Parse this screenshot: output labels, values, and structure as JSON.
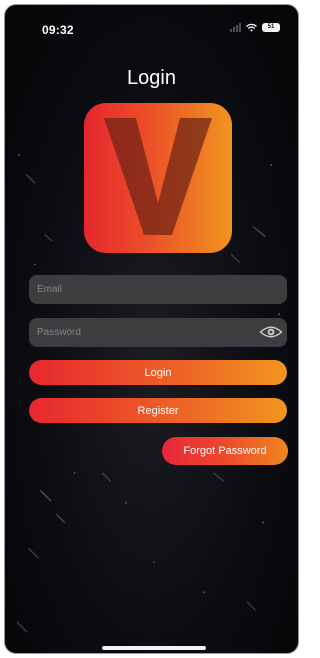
{
  "status_bar": {
    "time": "09:32",
    "battery": "51"
  },
  "page": {
    "title": "Login"
  },
  "logo": {
    "letter": "V",
    "gradient_start": "#e6262e",
    "gradient_end": "#f0951f"
  },
  "form": {
    "email_placeholder": "Email",
    "password_placeholder": "Password",
    "login_label": "Login",
    "register_label": "Register",
    "forgot_label": "Forgot Password"
  },
  "icons": {
    "password_toggle": "eye-icon"
  },
  "colors": {
    "background": "#0c0d11",
    "field": "#3d3d40",
    "accent_red": "#e6282e",
    "accent_orange": "#f2951f"
  }
}
